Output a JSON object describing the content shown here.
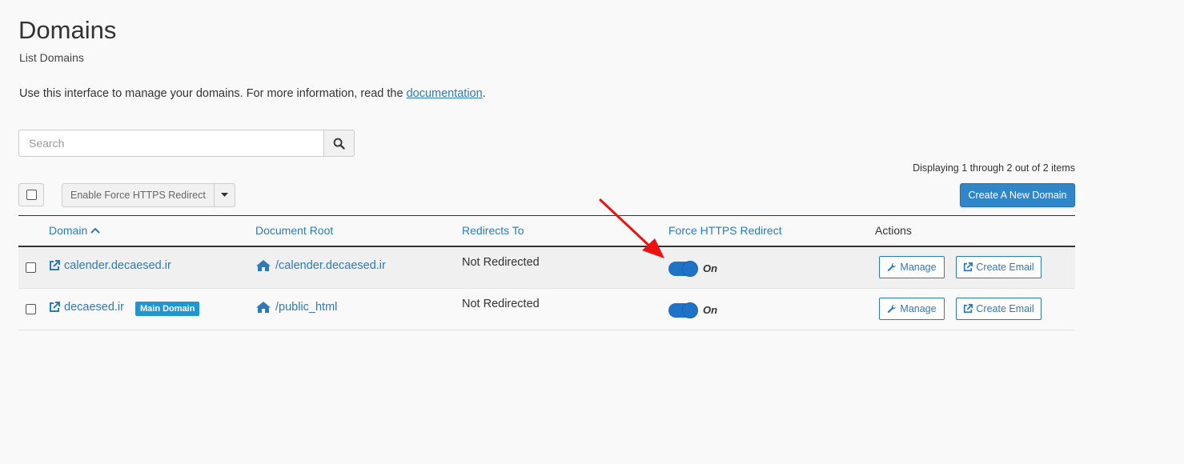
{
  "header": {
    "title": "Domains",
    "subtitle": "List Domains",
    "intro_text": "Use this interface to manage your domains. For more information, read the ",
    "intro_link": "documentation",
    "intro_end": "."
  },
  "search": {
    "placeholder": "Search",
    "value": ""
  },
  "toolbar": {
    "display_count": "Displaying 1 through 2 out of 2 items",
    "bulk_action_label": "Enable Force HTTPS Redirect",
    "create_button": "Create A New Domain"
  },
  "table": {
    "columns": [
      "Domain",
      "Document Root",
      "Redirects To",
      "Force HTTPS Redirect",
      "Actions"
    ],
    "rows": [
      {
        "domain": "calender.decaesed.ir",
        "badge": "",
        "doc_root": "/calender.decaesed.ir",
        "redirects_to": "Not Redirected",
        "https_state": "On",
        "manage": "Manage",
        "create_email": "Create Email"
      },
      {
        "domain": "decaesed.ir",
        "badge": "Main Domain",
        "doc_root": "/public_html",
        "redirects_to": "Not Redirected",
        "https_state": "On",
        "manage": "Manage",
        "create_email": "Create Email"
      }
    ]
  },
  "colors": {
    "accent": "#2d7ab8",
    "primary_button": "#2f86c9",
    "toggle": "#1e73c9",
    "badge": "#1e95d4",
    "annotation_arrow": "#ee1111"
  },
  "icons": [
    "search-icon",
    "caret-down-icon",
    "chevron-up-icon",
    "external-link-icon",
    "home-icon",
    "wrench-icon"
  ]
}
